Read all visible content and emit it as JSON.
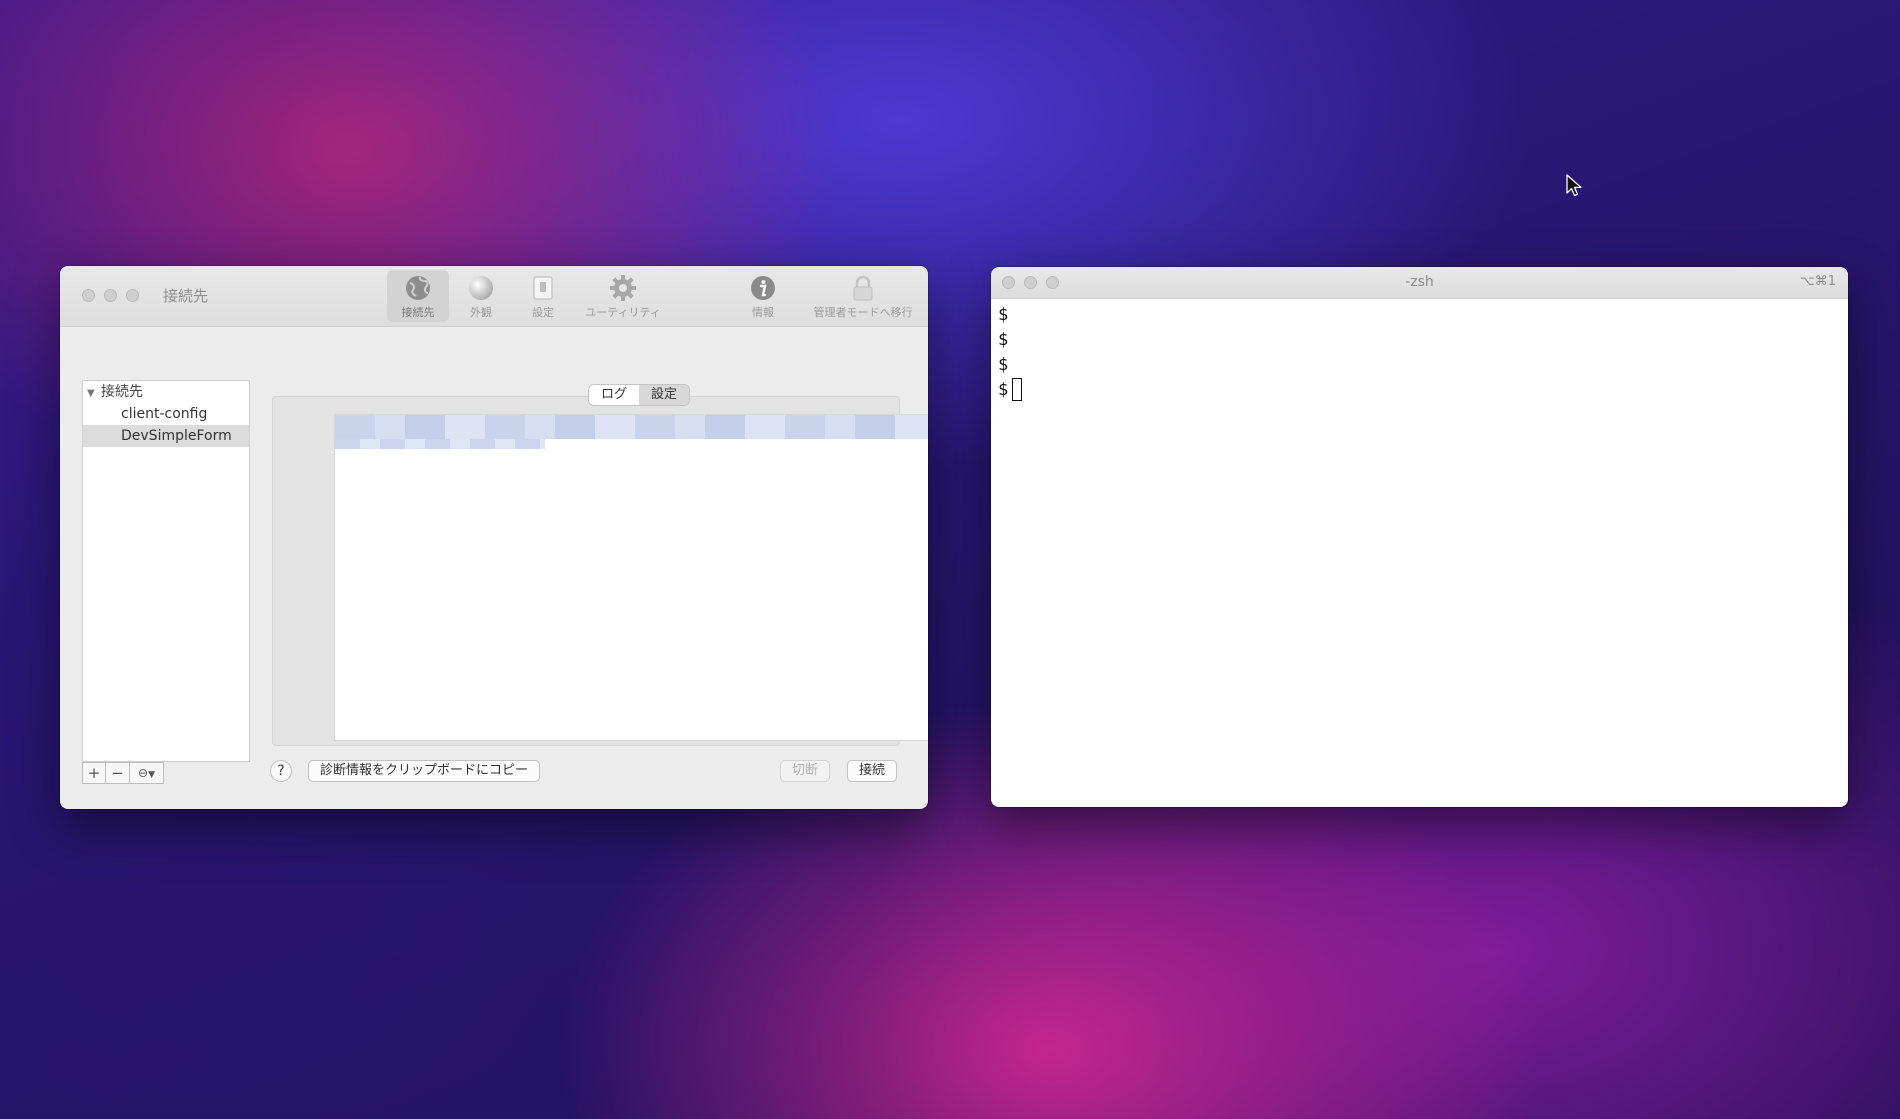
{
  "app_window": {
    "title": "接続先",
    "toolbar": [
      {
        "label": "接続先",
        "icon": "globe-icon",
        "active": true
      },
      {
        "label": "外観",
        "icon": "sphere-icon",
        "active": false
      },
      {
        "label": "設定",
        "icon": "switch-icon",
        "active": false
      },
      {
        "label": "ユーティリティ",
        "icon": "gear-icon",
        "active": false
      },
      {
        "label": "情報",
        "icon": "info-icon",
        "active": false
      },
      {
        "label": "管理者モードへ移行",
        "icon": "lock-icon",
        "active": false
      }
    ],
    "sidebar": {
      "group_label": "接続先",
      "items": [
        "client-config",
        "DevSimpleForm"
      ],
      "selected": "DevSimpleForm",
      "add_label": "+",
      "remove_label": "−"
    },
    "segments": {
      "log": "ログ",
      "settings": "設定",
      "selected": "ログ"
    },
    "help_label": "?",
    "copy_diag_label": "診断情報をクリップボードにコピー",
    "disconnect_label": "切断",
    "connect_label": "接続"
  },
  "terminal": {
    "title": "-zsh",
    "shortcut": "⌥⌘1",
    "prompt_lines": [
      "$",
      "$",
      "$",
      "$"
    ]
  }
}
